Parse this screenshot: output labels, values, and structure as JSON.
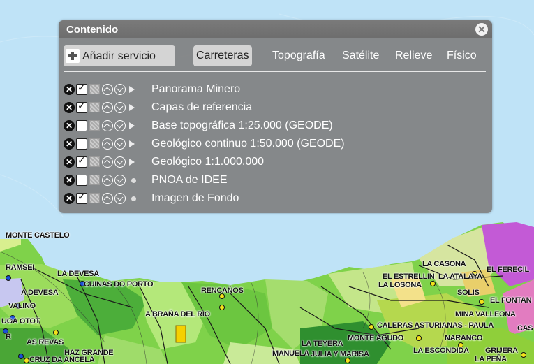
{
  "panel": {
    "title": "Contenido",
    "close_label": "✕",
    "add_service_label": "Añadir servicio",
    "tabs": [
      {
        "label": "Carreteras",
        "active": true
      },
      {
        "label": "Topografía",
        "active": false
      },
      {
        "label": "Satélite",
        "active": false
      },
      {
        "label": "Relieve",
        "active": false
      },
      {
        "label": "Físico",
        "active": false
      }
    ],
    "layers": [
      {
        "label": "Panorama Minero",
        "checked": true,
        "has_children": true
      },
      {
        "label": "Capas de referencia",
        "checked": true,
        "has_children": true
      },
      {
        "label": "Base topográfica 1:25.000 (GEODE)",
        "checked": false,
        "has_children": true
      },
      {
        "label": "Geológico continuo 1:50.000 (GEODE)",
        "checked": false,
        "has_children": true
      },
      {
        "label": "Geológico 1:1.000.000",
        "checked": true,
        "has_children": true
      },
      {
        "label": "PNOA de IDEE",
        "checked": false,
        "has_children": false
      },
      {
        "label": "Imagen de Fondo",
        "checked": true,
        "has_children": false
      }
    ]
  },
  "map": {
    "sea_color": "#bfe3f7",
    "place_labels": [
      "MONTE CASTELO",
      "RAMSEI",
      "LA DEVESA",
      "CUINAS DO PORTO",
      "A DEVESA",
      "RENCAÑOS",
      "VALINO",
      "UGA OTOT",
      "A BRAÑA DEL RIO",
      "R",
      "AS REVAS",
      "HAZ GRANDE",
      "CRUZ DA ANCELA",
      "LA CASONA",
      "EL FERECIL",
      "EL ESTRELLIN",
      "LA ATALAYA",
      "LA LOSONA",
      "SOLIS",
      "EL FONTAN",
      "MINA VALLEONA",
      "CALERAS ASTURIANAS - PAULA",
      "CAS",
      "LA TEYERA",
      "MONTE AGUDO",
      "NARANCO",
      "MANUELA",
      "JULIA Y MARISA",
      "LA ESCONDIDA",
      "GRIJERA",
      "LA PEÑA"
    ]
  }
}
